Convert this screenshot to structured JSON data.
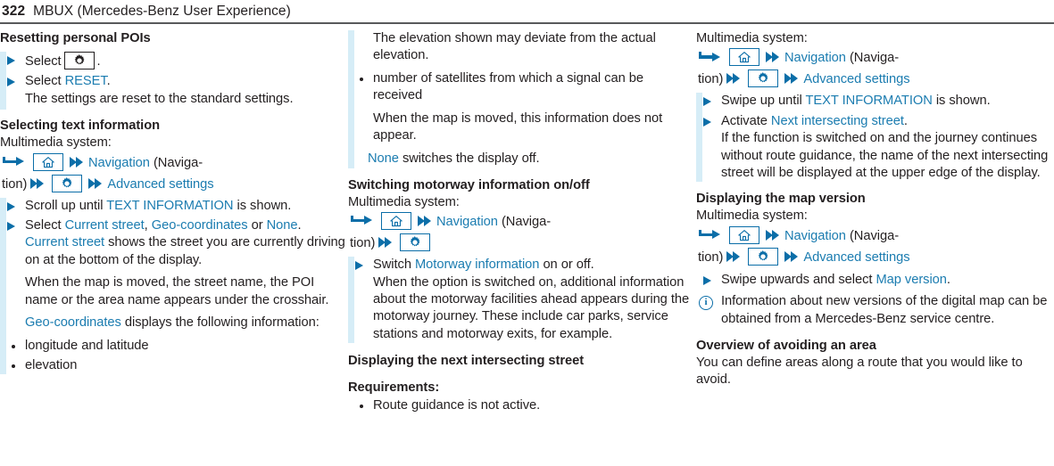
{
  "header": {
    "page_number": "322",
    "title": "MBUX (Mercedes-Benz User Experience)"
  },
  "colors": {
    "accent_blue": "#1b7cb0",
    "icon_blue": "#0b6ea8",
    "highlight_bar": "#d6edf7",
    "text": "#231f20",
    "rule": "#58595b"
  },
  "icons": {
    "arrow": "hooked-arrow-icon",
    "chevron": "double-chevron-icon",
    "home": "home-icon",
    "gear": "gear-icon",
    "info": "info-icon",
    "step": "triangle-bullet-icon",
    "info_glyph": "i"
  },
  "column1": {
    "heading1": "Resetting personal POIs",
    "step1_pre": "Select",
    "step1_post": ".",
    "step2_pre": "Select",
    "step2_link": "RESET",
    "step2_post": ".",
    "step2_cont": "The settings are reset to the standard settings.",
    "heading2": "Selecting text information",
    "multimedia_label": "Multimedia system:",
    "navpath": {
      "nav_link": "Navigation",
      "nav_paren_open": "(Naviga-",
      "nav_paren_close": "tion)",
      "advanced": "Advanced settings"
    },
    "step3_pre": "Scroll up until",
    "step3_link": "TEXT INFORMATION",
    "step3_post": "is shown.",
    "step4_pre": "Select",
    "step4_link1": "Current street",
    "step4_sep1": ",",
    "step4_link2": "Geo-coordinates",
    "step4_or": "or",
    "step4_link3": "None",
    "step4_post": ".",
    "para1_link": "Current street",
    "para1_text": "shows the street you are currently driving on at the bottom of the display.",
    "para2": "When the map is moved, the street name, the POI name or the area name appears under the crosshair.",
    "para3_link": "Geo-coordinates",
    "para3_text": "displays the following information:",
    "bullet1": "longitude and latitude",
    "bullet2": "elevation"
  },
  "column2": {
    "cont_text": "The elevation shown may deviate from the actual elevation.",
    "bullet1": "number of satellites from which a signal can be received",
    "cont_text2": "When the map is moved, this information does not appear.",
    "none_link": "None",
    "none_text": "switches the display off.",
    "heading1": "Switching motorway information on/off",
    "multimedia_label": "Multimedia system:",
    "navpath": {
      "nav_link": "Navigation",
      "nav_paren_open": "(Naviga-",
      "nav_paren_close": "tion)"
    },
    "step1_pre": "Switch",
    "step1_link": "Motorway information",
    "step1_post": "on or off.",
    "step1_cont": "When the option is switched on, additional information about the motorway facilities ahead appears during the motorway journey. These include car parks, service stations and motorway exits, for example.",
    "heading2": "Displaying the next intersecting street",
    "heading3": "Requirements:",
    "bullet2": "Route guidance is not active."
  },
  "column3": {
    "multimedia_label": "Multimedia system:",
    "navpath": {
      "nav_link": "Navigation",
      "nav_paren_open": "(Naviga-",
      "nav_paren_close": "tion)",
      "advanced": "Advanced settings"
    },
    "step1_pre": "Swipe up until",
    "step1_link": "TEXT INFORMATION",
    "step1_post": "is shown.",
    "step2_pre": "Activate",
    "step2_link": "Next intersecting street",
    "step2_post": ".",
    "step2_cont": "If the function is switched on and the journey continues without route guidance, the name of the next intersecting street will be displayed at the upper edge of the display.",
    "heading1": "Displaying the map version",
    "multimedia_label2": "Multimedia system:",
    "navpath2": {
      "nav_link": "Navigation",
      "nav_paren_open": "(Naviga-",
      "nav_paren_close": "tion)",
      "advanced": "Advanced settings"
    },
    "step3_pre": "Swipe upwards and select",
    "step3_link": "Map version",
    "step3_post": ".",
    "note": "Information about new versions of the digital map can be obtained from a Mercedes-Benz service centre.",
    "heading2": "Overview of avoiding an area",
    "para": "You can define areas along a route that you would like to avoid."
  }
}
